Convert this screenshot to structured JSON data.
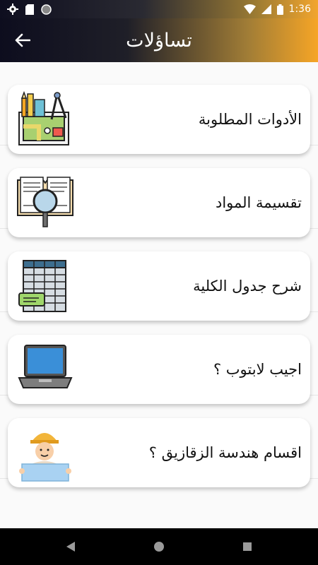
{
  "status_bar": {
    "time": "1:36"
  },
  "app_bar": {
    "title": "تساؤلات",
    "back_icon": "arrow-left-icon"
  },
  "items": [
    {
      "label": "الأدوات المطلوبة",
      "icon": "drawing-tools-icon"
    },
    {
      "label": "تقسيمة المواد",
      "icon": "book-magnifier-icon"
    },
    {
      "label": "شرح جدول الكلية",
      "icon": "spreadsheet-table-icon"
    },
    {
      "label": "اجيب لابتوب ؟",
      "icon": "laptop-icon"
    },
    {
      "label": "اقسام هندسة الزقازيق ؟",
      "icon": "engineer-icon"
    }
  ],
  "colors": {
    "gradient_start": "#0d0d1e",
    "gradient_end": "#f6a526",
    "card_bg": "#ffffff"
  }
}
